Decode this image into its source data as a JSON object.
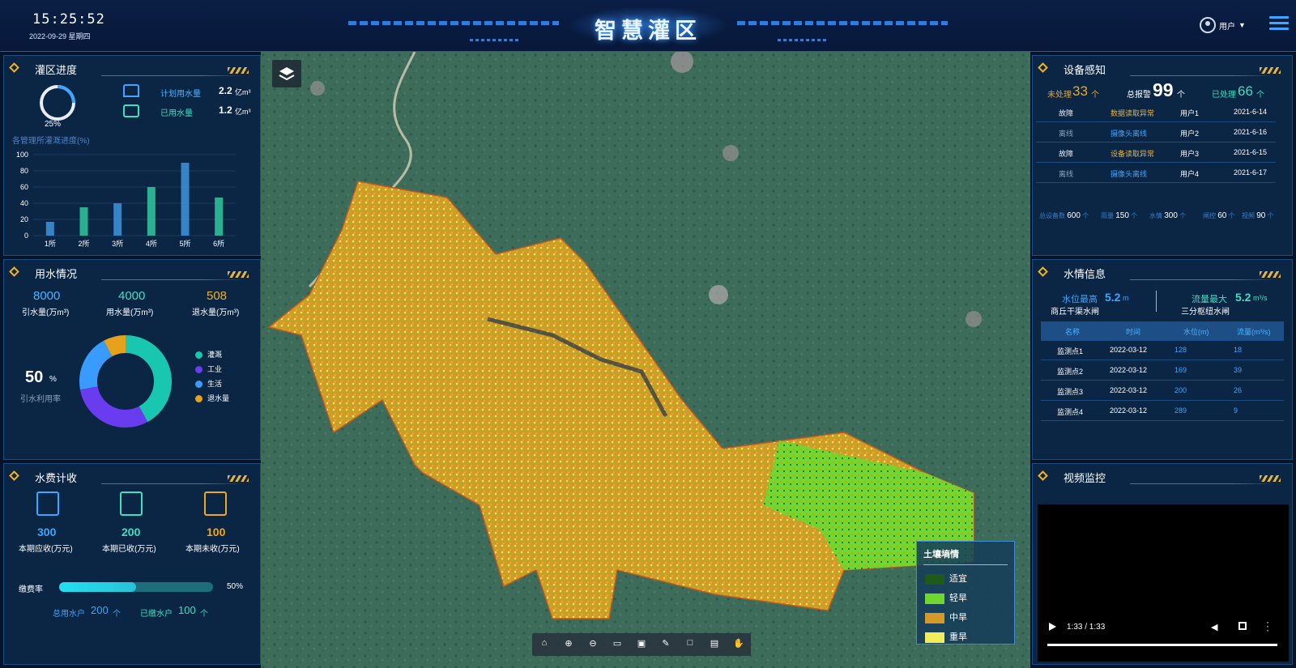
{
  "header": {
    "time": "15:25:52",
    "date": "2022-09-29 星期四",
    "title": "智慧灌区",
    "user": "用户"
  },
  "progress": {
    "title": "灌区进度",
    "percent_label": "25%",
    "percent": 0.25,
    "plan_label": "计划用水量",
    "plan_value": "2.2",
    "plan_unit": "亿m³",
    "used_label": "已用水量",
    "used_value": "1.2",
    "used_unit": "亿m³",
    "chart_title": "各管理所灌溉进度(%)"
  },
  "chart_data": {
    "type": "bar",
    "categories": [
      "1所",
      "2所",
      "3所",
      "4所",
      "5所",
      "6所"
    ],
    "values": [
      17,
      35,
      40,
      60,
      90,
      47
    ],
    "title": "各管理所灌溉进度(%)",
    "ylim": [
      0,
      100
    ],
    "yticks": [
      "0",
      "20",
      "40",
      "60",
      "80",
      "100"
    ]
  },
  "usage": {
    "title": "用水情况",
    "stats": [
      {
        "value": "8000",
        "label": "引水量(万m³)",
        "color": "#4db3ff"
      },
      {
        "value": "4000",
        "label": "用水量(万m³)",
        "color": "#3ee0c0"
      },
      {
        "value": "508",
        "label": "退水量(万m³)",
        "color": "#e7b33b"
      }
    ],
    "rate_value": "50",
    "rate_unit": "%",
    "rate_label": "引水利用率",
    "donut": [
      {
        "name": "灌溉",
        "value": 42,
        "color": "#19c7b0"
      },
      {
        "name": "工业",
        "value": 30,
        "color": "#6a3cf0"
      },
      {
        "name": "生活",
        "value": 20,
        "color": "#3a9bff"
      },
      {
        "name": "退水量",
        "value": 8,
        "color": "#e5a21a"
      }
    ]
  },
  "fee": {
    "title": "水费计收",
    "items": [
      {
        "value": "300",
        "label": "本期应收(万元)",
        "color": "#3ea6ff"
      },
      {
        "value": "200",
        "label": "本期已收(万元)",
        "color": "#3ee0c0"
      },
      {
        "value": "100",
        "label": "本期未收(万元)",
        "color": "#f0a81c"
      }
    ],
    "rate_label": "缴费率",
    "rate": 0.5,
    "rate_text": "50%",
    "total_label": "总用水户",
    "total_value": "200",
    "total_unit": "个",
    "paid_label": "已缴水户",
    "paid_value": "100",
    "paid_unit": "个"
  },
  "device": {
    "title": "设备感知",
    "pending_label": "未处理",
    "pending": "33",
    "unit": "个",
    "total_label": "总报警",
    "total": "99",
    "done_label": "已处理",
    "done": "66",
    "rows": [
      {
        "type": "故障",
        "desc": "数据读取异常",
        "user": "用户1",
        "date": "2021-6-14",
        "tc": "#e8edf5",
        "dc": "#e7b33b"
      },
      {
        "type": "离线",
        "desc": "摄像头离线",
        "user": "用户2",
        "date": "2021-6-16",
        "tc": "#8aa2bd",
        "dc": "#3ea6ff"
      },
      {
        "type": "故障",
        "desc": "设备读取异常",
        "user": "用户3",
        "date": "2021-6-15",
        "tc": "#e8edf5",
        "dc": "#e7b33b"
      },
      {
        "type": "离线",
        "desc": "摄像头离线",
        "user": "用户4",
        "date": "2021-6-17",
        "tc": "#8aa2bd",
        "dc": "#3ea6ff"
      }
    ],
    "summary": [
      {
        "label": "总设备数",
        "value": "600",
        "unit": "个"
      },
      {
        "label": "雨量",
        "value": "150",
        "unit": "个"
      },
      {
        "label": "水情",
        "value": "300",
        "unit": "个"
      },
      {
        "label": "闸控",
        "value": "60",
        "unit": "个"
      },
      {
        "label": "视频",
        "value": "90",
        "unit": "个"
      }
    ]
  },
  "water": {
    "title": "水情信息",
    "max_level_label": "水位最高",
    "max_level_value": "5.2",
    "max_level_unit": "m",
    "max_level_site": "商丘干渠水闸",
    "max_flow_label": "流量最大",
    "max_flow_value": "5.2",
    "max_flow_unit": "m³/s",
    "max_flow_site": "三分枢纽水闸",
    "columns": [
      "名称",
      "时间",
      "水位(m)",
      "流量(m³/s)"
    ],
    "rows": [
      [
        "监测点1",
        "2022-03-12",
        "128",
        "18"
      ],
      [
        "监测点2",
        "2022-03-12",
        "169",
        "39"
      ],
      [
        "监测点3",
        "2022-03-12",
        "200",
        "26"
      ],
      [
        "监测点4",
        "2022-03-12",
        "289",
        "9"
      ]
    ]
  },
  "video": {
    "title": "视频监控",
    "time": "1:33 / 1:33"
  },
  "legend": {
    "title": "土壤墒情",
    "items": [
      {
        "name": "适宜",
        "color": "#1f5a1a"
      },
      {
        "name": "轻旱",
        "color": "#6fd82e"
      },
      {
        "name": "中旱",
        "color": "#d49a25"
      },
      {
        "name": "重旱",
        "color": "#f0ec5a"
      }
    ]
  },
  "toolbar": [
    "home-icon",
    "zoom-in-icon",
    "zoom-out-icon",
    "measure-icon",
    "fullscreen-map-icon",
    "draw-icon",
    "select-box-icon",
    "map-icon",
    "pan-hand-icon"
  ]
}
